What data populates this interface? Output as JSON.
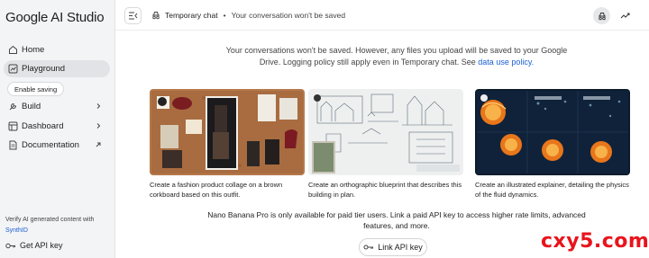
{
  "sidebar": {
    "brand": "Google AI Studio",
    "items": [
      {
        "label": "Home",
        "icon": "home-icon"
      },
      {
        "label": "Playground",
        "icon": "playground-icon"
      },
      {
        "label": "Build",
        "icon": "build-icon"
      },
      {
        "label": "Dashboard",
        "icon": "dashboard-icon"
      },
      {
        "label": "Documentation",
        "icon": "doc-icon"
      }
    ],
    "tooltip": "Enable saving",
    "verify_text": "Verify AI generated content with",
    "verify_link": "SynthID",
    "api_key": "Get API key"
  },
  "topbar": {
    "title": "Temporary chat",
    "separator": "•",
    "subtitle": "Your conversation won't be saved"
  },
  "main": {
    "notice_text": "Your conversations won't be saved. However, any files you upload will be saved to your Google Drive. Logging policy still apply even in Temporary chat. See",
    "notice_link": "data use policy.",
    "cards": [
      {
        "caption": "Create a fashion product collage on a brown corkboard based on this outfit."
      },
      {
        "caption": "Create an orthographic blueprint that describes this building in plan."
      },
      {
        "caption": "Create an illustrated explainer, detailing the physics of the fluid dynamics."
      }
    ],
    "paid_notice": "Nano Banana Pro is only available for paid tier users. Link a paid API key to access higher rate limits, advanced features, and more.",
    "link_button": "Link API key"
  },
  "watermark": "cxy5.com",
  "colors": {
    "link": "#1a5fd0",
    "sidebar_bg": "#f3f4f6",
    "watermark": "#e8141c"
  }
}
